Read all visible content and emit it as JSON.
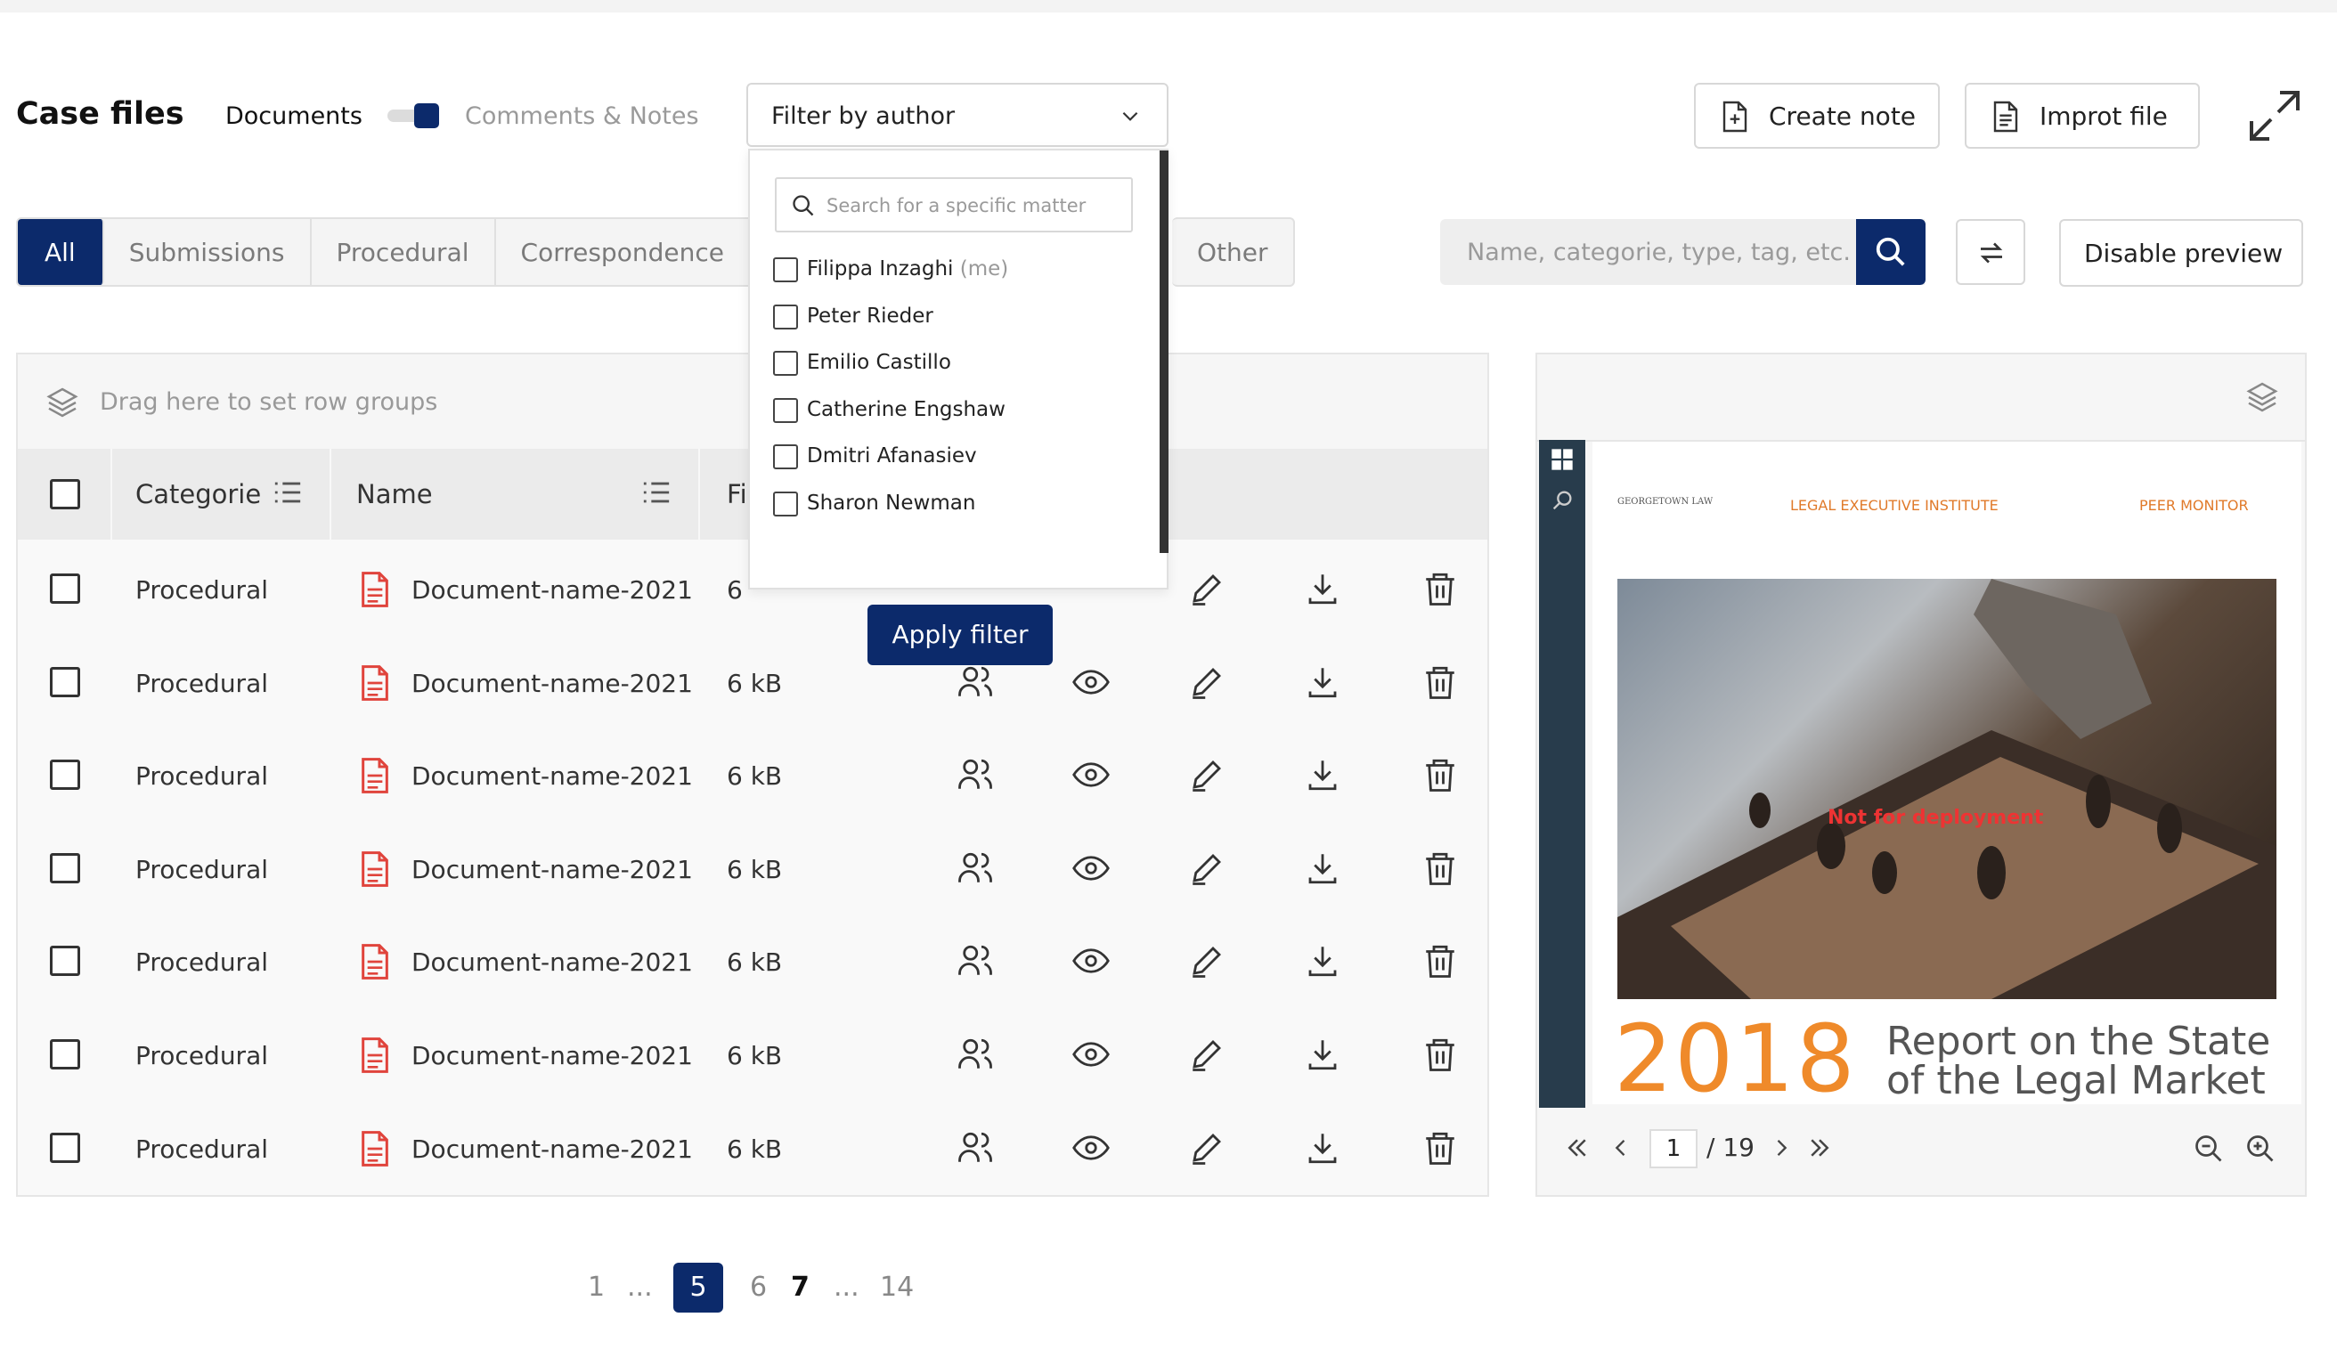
{
  "header": {
    "title": "Case files",
    "documents_label": "Documents",
    "comments_label": "Comments & Notes",
    "filter_author_label": "Filter by author",
    "create_note_label": "Create note",
    "import_file_label": "Improt file"
  },
  "tabs": [
    "All",
    "Submissions",
    "Procedural",
    "Correspondence",
    "Other"
  ],
  "search": {
    "placeholder": "Name, categorie, type, tag, etc."
  },
  "disable_preview_label": "Disable preview",
  "author_dropdown": {
    "search_placeholder": "Search for a specific matter",
    "authors": [
      {
        "name": "Filippa Inzaghi",
        "suffix": "(me)"
      },
      {
        "name": "Peter Rieder",
        "suffix": ""
      },
      {
        "name": "Emilio Castillo",
        "suffix": ""
      },
      {
        "name": "Catherine Engshaw",
        "suffix": ""
      },
      {
        "name": "Dmitri Afanasiev",
        "suffix": ""
      },
      {
        "name": "Sharon Newman",
        "suffix": ""
      }
    ],
    "apply_label": "Apply filter"
  },
  "grid": {
    "drag_hint": "Drag here to set row groups",
    "columns": {
      "category": "Categorie",
      "name": "Name",
      "file": "Fi"
    },
    "rows": [
      {
        "category": "Procedural",
        "name": "Document-name-2021",
        "size": "6"
      },
      {
        "category": "Procedural",
        "name": "Document-name-2021",
        "size": "6 kB"
      },
      {
        "category": "Procedural",
        "name": "Document-name-2021",
        "size": "6 kB"
      },
      {
        "category": "Procedural",
        "name": "Document-name-2021",
        "size": "6 kB"
      },
      {
        "category": "Procedural",
        "name": "Document-name-2021",
        "size": "6 kB"
      },
      {
        "category": "Procedural",
        "name": "Document-name-2021",
        "size": "6 kB"
      },
      {
        "category": "Procedural",
        "name": "Document-name-2021",
        "size": "6 kB"
      }
    ]
  },
  "preview": {
    "logo_left": "GEORGETOWN LAW",
    "logo_middle": "LEGAL EXECUTIVE INSTITUTE",
    "logo_right": "PEER MONITOR",
    "watermark": "Not for deployment",
    "year": "2018",
    "report_line1": "Report on the State",
    "report_line2": "of the Legal Market",
    "current_page": "1",
    "total_pages": "/ 19"
  },
  "pagination": {
    "first": "1",
    "ellipsis1": "...",
    "current": "5",
    "next1": "6",
    "next2": "7",
    "ellipsis2": "...",
    "last": "14"
  },
  "colors": {
    "accent": "#0c2a6b",
    "pdf_red": "#e0443c",
    "orange": "#ef8a2a"
  }
}
